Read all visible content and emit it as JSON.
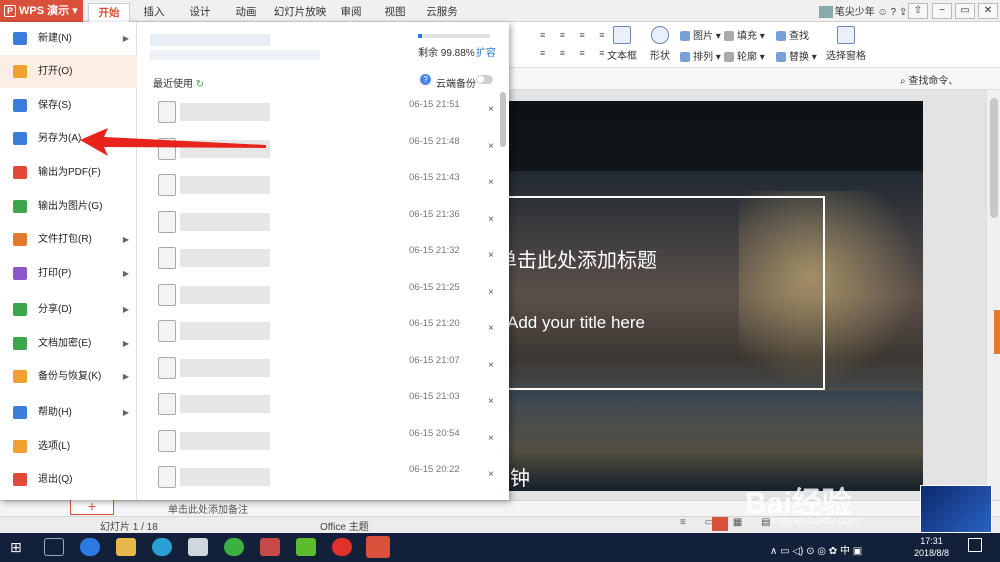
{
  "app": {
    "name": "WPS 演示",
    "logo": "P"
  },
  "tabs": [
    "开始",
    "插入",
    "设计",
    "动画",
    "幻灯片放映",
    "审阅",
    "视图",
    "云服务"
  ],
  "user": {
    "name": "笔尖少年"
  },
  "ribbon": {
    "textbox": "文本框",
    "shape": "形状",
    "picture": "图片",
    "arrange": "排列",
    "fill": "填充",
    "outline": "轮廓",
    "find": "查找",
    "replace": "替换",
    "select_pane": "选择窗格",
    "search_cmd": "查找命令、"
  },
  "file_menu": {
    "items": [
      {
        "label": "新建(N)",
        "icon": "new-file-icon",
        "color": "#3b7dd8",
        "arrow": true
      },
      {
        "label": "打开(O)",
        "icon": "open-folder-icon",
        "color": "#f0a030",
        "arrow": false,
        "active": true
      },
      {
        "label": "保存(S)",
        "icon": "save-icon",
        "color": "#3b7dd8",
        "arrow": false
      },
      {
        "label": "另存为(A)",
        "icon": "save-as-icon",
        "color": "#3b7dd8",
        "arrow": false
      },
      {
        "label": "输出为PDF(F)",
        "icon": "pdf-icon",
        "color": "#e04a3a",
        "arrow": false
      },
      {
        "label": "输出为图片(G)",
        "icon": "image-export-icon",
        "color": "#3da64a",
        "arrow": false
      },
      {
        "label": "文件打包(R)",
        "icon": "package-icon",
        "color": "#e07a30",
        "arrow": true
      },
      {
        "label": "打印(P)",
        "icon": "print-icon",
        "color": "#8a56c8",
        "arrow": true
      },
      {
        "label": "分享(D)",
        "icon": "share-icon",
        "color": "#3da64a",
        "arrow": true
      },
      {
        "label": "文档加密(E)",
        "icon": "encrypt-icon",
        "color": "#3da64a",
        "arrow": true
      },
      {
        "label": "备份与恢复(K)",
        "icon": "backup-icon",
        "color": "#f0a030",
        "arrow": true
      },
      {
        "label": "帮助(H)",
        "icon": "help-icon",
        "color": "#3b7dd8",
        "arrow": true
      },
      {
        "label": "选项(L)",
        "icon": "gear-icon",
        "color": "#f0a030",
        "arrow": false
      },
      {
        "label": "退出(Q)",
        "icon": "exit-icon",
        "color": "#e04a3a",
        "arrow": false
      }
    ]
  },
  "cloud": {
    "remaining": "剩余 99.88%",
    "expand": "扩容",
    "used_fraction": 0.05
  },
  "recent": {
    "label": "最近使用",
    "backup_label": "云端备份",
    "files": [
      {
        "time": "06-15 21:51"
      },
      {
        "time": "06-15 21:48"
      },
      {
        "time": "06-15 21:43"
      },
      {
        "time": "06-15 21:36"
      },
      {
        "time": "06-15 21:32"
      },
      {
        "time": "06-15 21:25"
      },
      {
        "time": "06-15 21:20"
      },
      {
        "time": "06-15 21:07"
      },
      {
        "time": "06-15 21:03"
      },
      {
        "time": "06-15 20:54"
      },
      {
        "time": "06-15 20:22"
      }
    ],
    "close_glyph": "×"
  },
  "slide": {
    "title_cn": "单击此处添加标题",
    "title_en": "Add your title here",
    "subtitle_fragment": "钟"
  },
  "notes": {
    "placeholder": "单击此处添加备注"
  },
  "status": {
    "slide_counter": "幻灯片 1 / 18",
    "theme": "Office 主题"
  },
  "taskbar": {
    "time": "17:31",
    "date": "2018/8/8",
    "ime": "中"
  },
  "watermark": {
    "brand": "Bai经验",
    "url": "jingyan.baidu.com"
  }
}
